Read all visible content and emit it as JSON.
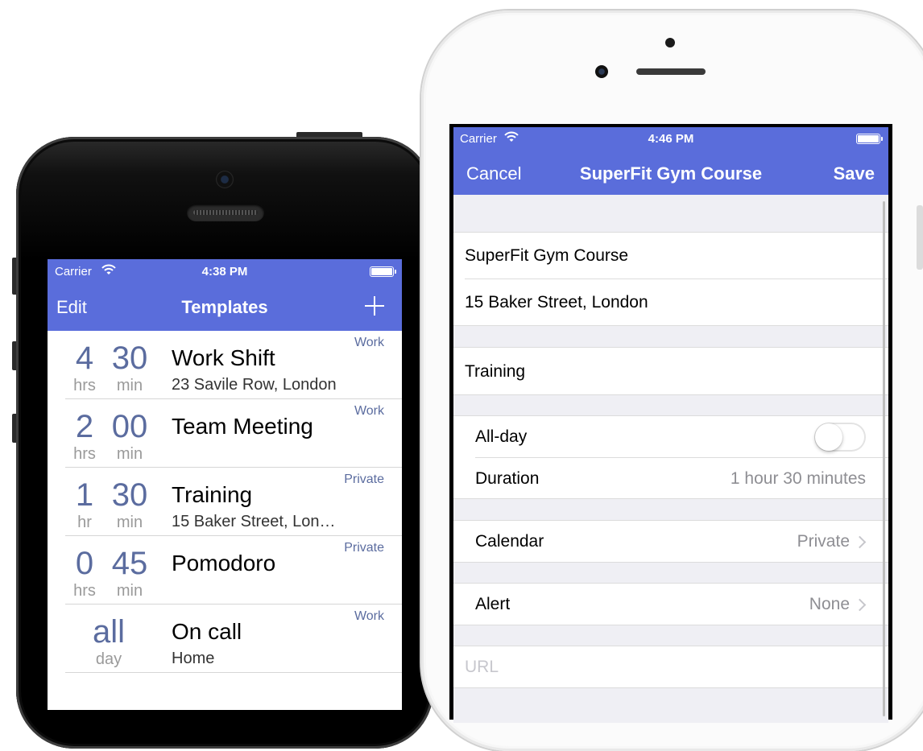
{
  "left_phone": {
    "status": {
      "carrier": "Carrier",
      "time": "4:38 PM"
    },
    "nav": {
      "left": "Edit",
      "title": "Templates"
    },
    "rows": [
      {
        "num1": "4",
        "num2": "30",
        "unit1": "hrs",
        "unit2": "min",
        "title": "Work Shift",
        "subtitle": "23 Savile Row, London",
        "calendar": "Work"
      },
      {
        "num1": "2",
        "num2": "00",
        "unit1": "hrs",
        "unit2": "min",
        "title": "Team Meeting",
        "subtitle": "",
        "calendar": "Work"
      },
      {
        "num1": "1",
        "num2": "30",
        "unit1": "hr",
        "unit2": "min",
        "title": "Training",
        "subtitle": "15 Baker Street, Lon…",
        "calendar": "Private"
      },
      {
        "num1": "0",
        "num2": "45",
        "unit1": "hrs",
        "unit2": "min",
        "title": "Pomodoro",
        "subtitle": "",
        "calendar": "Private"
      },
      {
        "all": "all",
        "all_unit": "day",
        "title": "On call",
        "subtitle": "Home",
        "calendar": "Work"
      }
    ]
  },
  "right_phone": {
    "status": {
      "carrier": "Carrier",
      "time": "4:46 PM"
    },
    "nav": {
      "left": "Cancel",
      "title": "SuperFit Gym Course",
      "right": "Save"
    },
    "fields": {
      "title": "SuperFit Gym Course",
      "location": "15 Baker Street, London",
      "notes": "Training",
      "allday_label": "All-day",
      "allday_on": false,
      "duration_label": "Duration",
      "duration_value": "1 hour 30 minutes",
      "calendar_label": "Calendar",
      "calendar_value": "Private",
      "alert_label": "Alert",
      "alert_value": "None",
      "url_placeholder": "URL"
    }
  },
  "colors": {
    "accent": "#5a6ddb",
    "duration_text": "#5b6c9f",
    "calendar_tag": "#5b6c9f"
  }
}
